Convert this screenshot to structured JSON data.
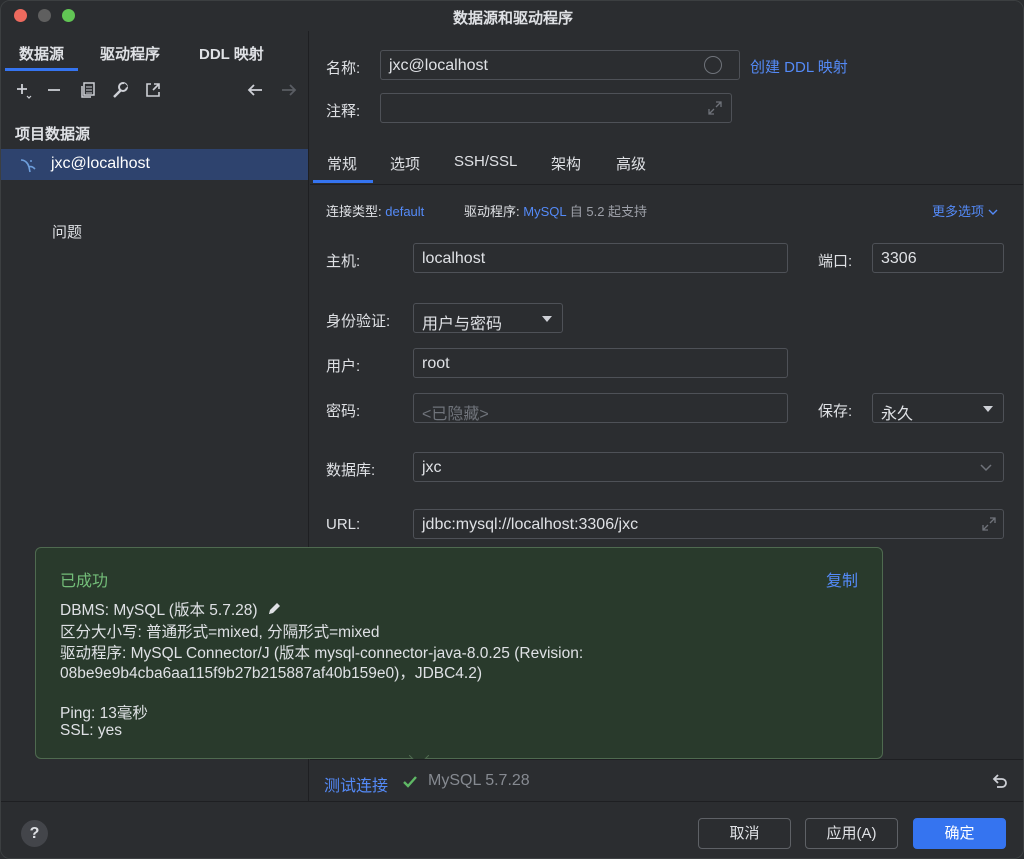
{
  "window": {
    "title": "数据源和驱动程序"
  },
  "left": {
    "tabs": [
      "数据源",
      "驱动程序",
      "DDL 映射"
    ],
    "section_label": "项目数据源",
    "datasource": "jxc@localhost",
    "problems": "问题"
  },
  "form": {
    "name_label": "名称:",
    "name_value": "jxc@localhost",
    "create_ddl_link": "创建 DDL 映射",
    "comment_label": "注释:",
    "comment_value": "",
    "tabs": [
      "常规",
      "选项",
      "SSH/SSL",
      "架构",
      "高级"
    ],
    "conn_type_label": "连接类型:",
    "conn_type_value": "default",
    "driver_label": "驱动程序:",
    "driver_value": "MySQL",
    "driver_note": "自 5.2 起支持",
    "more_options": "更多选项",
    "host_label": "主机:",
    "host_value": "localhost",
    "port_label": "端口:",
    "port_value": "3306",
    "auth_label": "身份验证:",
    "auth_value": "用户与密码",
    "user_label": "用户:",
    "user_value": "root",
    "password_label": "密码:",
    "password_placeholder": "<已隐藏>",
    "save_label": "保存:",
    "save_value": "永久",
    "database_label": "数据库:",
    "database_value": "jxc",
    "url_label": "URL:",
    "url_value": "jdbc:mysql://localhost:3306/jxc"
  },
  "popup": {
    "status": "已成功",
    "copy": "复制",
    "dbms": "DBMS: MySQL (版本 5.7.28)",
    "case": "区分大小写: 普通形式=mixed, 分隔形式=mixed",
    "driver_line1": "驱动程序: MySQL Connector/J (版本 mysql-connector-java-8.0.25 (Revision:",
    "driver_line2": "08be9e9b4cba6aa115f9b27b215887af40b159e0)，JDBC4.2)",
    "ping": "Ping: 13毫秒",
    "ssl": "SSL: yes"
  },
  "status": {
    "test_link": "测试连接",
    "result": "MySQL 5.7.28"
  },
  "footer": {
    "help": "?",
    "cancel": "取消",
    "apply": "应用(A)",
    "ok": "确定"
  },
  "colors": {
    "accent": "#3574f0",
    "link": "#548af7",
    "success": "#73bd79"
  }
}
